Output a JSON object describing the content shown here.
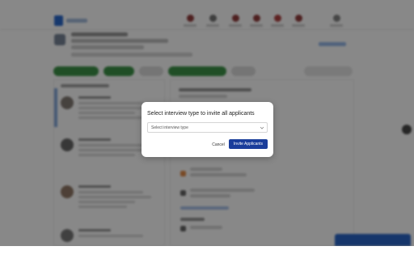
{
  "modal": {
    "title": "Select interview type to invite all applicants",
    "select_placeholder": "Select interview type",
    "cancel_label": "Cancel",
    "invite_label": "Invite Applicants"
  },
  "colors": {
    "primary": "#1a3d9b",
    "tab_green": "#2e8b3a",
    "overlay": "rgba(18,18,18,0.5)"
  },
  "icons": {
    "select_chevron": "chevron-down-icon"
  }
}
